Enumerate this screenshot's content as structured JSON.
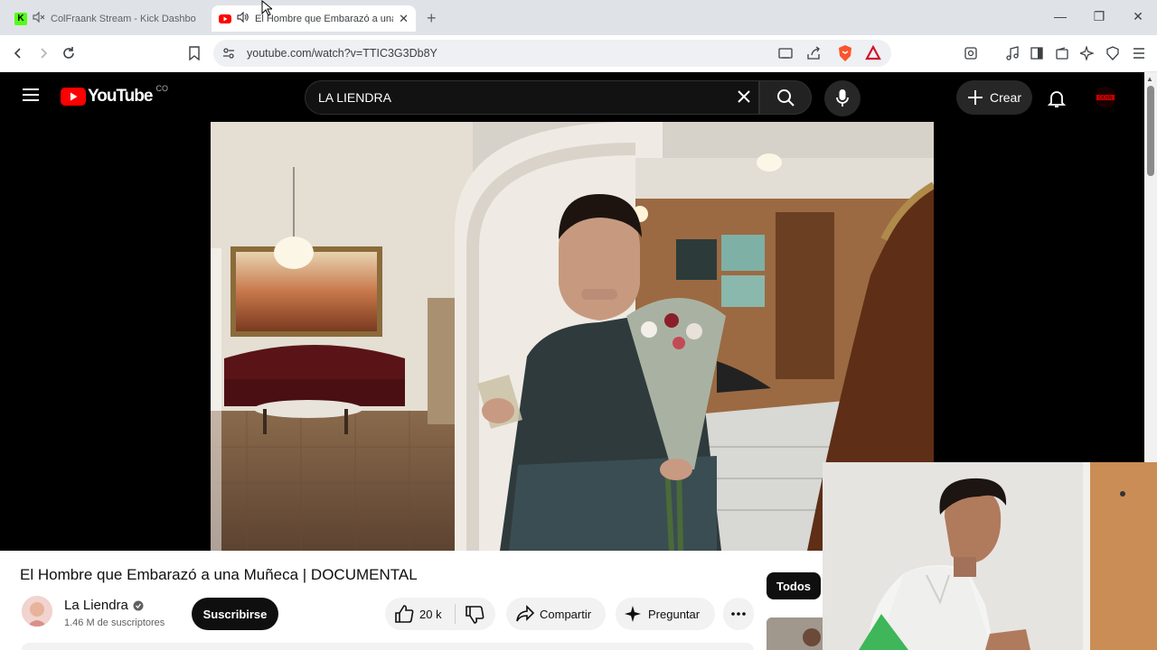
{
  "browser": {
    "tabs": [
      {
        "title": "ColFraank Stream - Kick Dashbo",
        "favicon": "kick-logo-icon",
        "muted": true
      },
      {
        "title": "El Hombre que Embarazó a una",
        "favicon": "youtube-favicon-icon",
        "playing_audio": true
      }
    ],
    "url": "youtube.com/watch?v=TTIC3G3Db8Y",
    "brave_badge_color": "#fb542b"
  },
  "youtube": {
    "logo_text": "YouTube",
    "country_code": "CO",
    "search_value": "LA LIENDRA",
    "create_label": "Crear",
    "video": {
      "title": "El Hombre que Embarazó a una Muñeca | DOCUMENTAL"
    },
    "channel": {
      "name": "La Liendra",
      "subscribers": "1.46 M de suscriptores",
      "verified": true
    },
    "subscribe_label": "Suscribirse",
    "likes": "20 k",
    "share_label": "Compartir",
    "ask_label": "Preguntar",
    "filter_chip": "Todos",
    "brand_red": "#ff0000"
  }
}
